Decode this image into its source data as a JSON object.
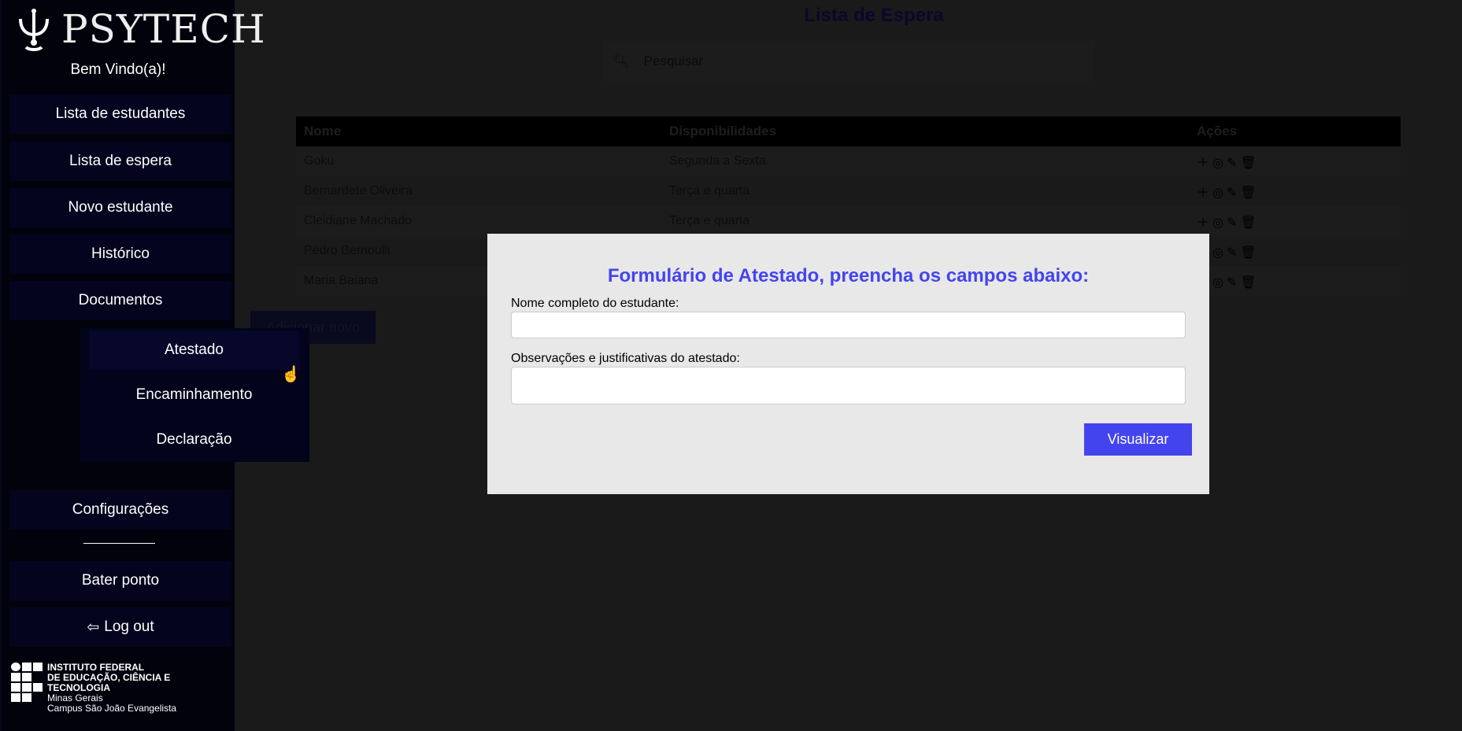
{
  "brand": {
    "name": "PSYTECH"
  },
  "sidebar": {
    "welcome": "Bem Vindo(a)!",
    "items": [
      {
        "label": "Lista de estudantes"
      },
      {
        "label": "Lista de espera"
      },
      {
        "label": "Novo estudante"
      },
      {
        "label": "Histórico"
      },
      {
        "label": "Documentos"
      }
    ],
    "documents_menu": [
      {
        "label": "Atestado"
      },
      {
        "label": "Encaminhamento"
      },
      {
        "label": "Declaração"
      }
    ],
    "settings": "Configurações",
    "clock_in": "Bater ponto",
    "logout": "Log out",
    "institution": {
      "line1": "INSTITUTO FEDERAL",
      "line2": "DE EDUCAÇÃO, CIÊNCIA E TECNOLOGIA",
      "line3": "Minas Gerais",
      "line4": "Campus São João Evangelista"
    }
  },
  "main": {
    "title": "Lista de Espera",
    "search_placeholder": "Pesquisar",
    "table": {
      "headers": [
        "Nome",
        "Disponibilidades",
        "Ações"
      ],
      "rows": [
        [
          "Goku",
          "Segunda a Sexta"
        ],
        [
          "Bernardete Oliveira",
          "Terça e quarta"
        ],
        [
          "Cleidiane Machado",
          "Terça e quarta"
        ],
        [
          "Pedro Bernoulli",
          ""
        ],
        [
          "Maria Baiana",
          ""
        ]
      ]
    },
    "add_button": "Adicionar novo"
  },
  "modal": {
    "title": "Formulário de Atestado, preencha os campos abaixo:",
    "name_label": "Nome completo do estudante:",
    "name_value": "",
    "obs_label": "Observações e justificativas do atestado:",
    "obs_value": "",
    "submit": "Visualizar"
  },
  "colors": {
    "accent": "#4444ee",
    "sidebar": "#02020d",
    "overlay_bg": "#1a1a1a"
  }
}
